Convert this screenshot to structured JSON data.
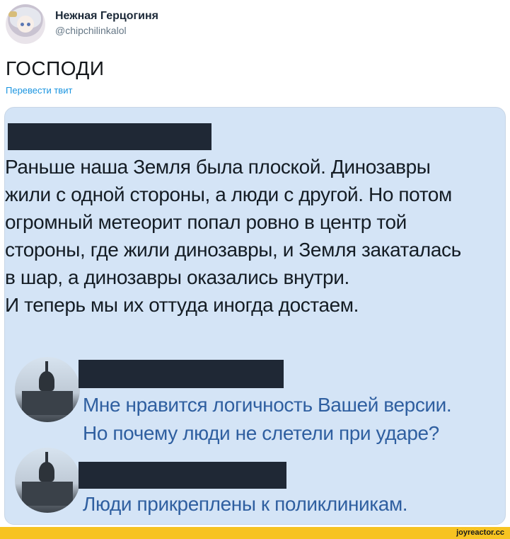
{
  "tweet": {
    "display_name": "Нежная Герцогиня",
    "handle": "@chipchilinkalol",
    "text": "ГОСПОДИ",
    "translate_link": "Перевести твит"
  },
  "image_post": {
    "text": "Раньше наша Земля была плоской. Динозавры\nжили с одной стороны, а люди с другой. Но потом\nогромный метеорит попал ровно в центр той\nстороны, где жили динозавры, и Земля закаталась\nв шар, а динозавры оказались внутри.\nИ теперь мы их оттуда иногда достаем."
  },
  "replies": [
    {
      "text": "Мне нравится логичность Вашей версии.\nНо почему люди не слетели при ударе?"
    },
    {
      "text": "Люди прикреплены к поликлиникам."
    }
  ],
  "watermark": "joyreactor.cc",
  "colors": {
    "card_bg": "#d4e4f6",
    "reply_text": "#2f5fa0",
    "link": "#1b95e0",
    "footer": "#f7c321"
  }
}
